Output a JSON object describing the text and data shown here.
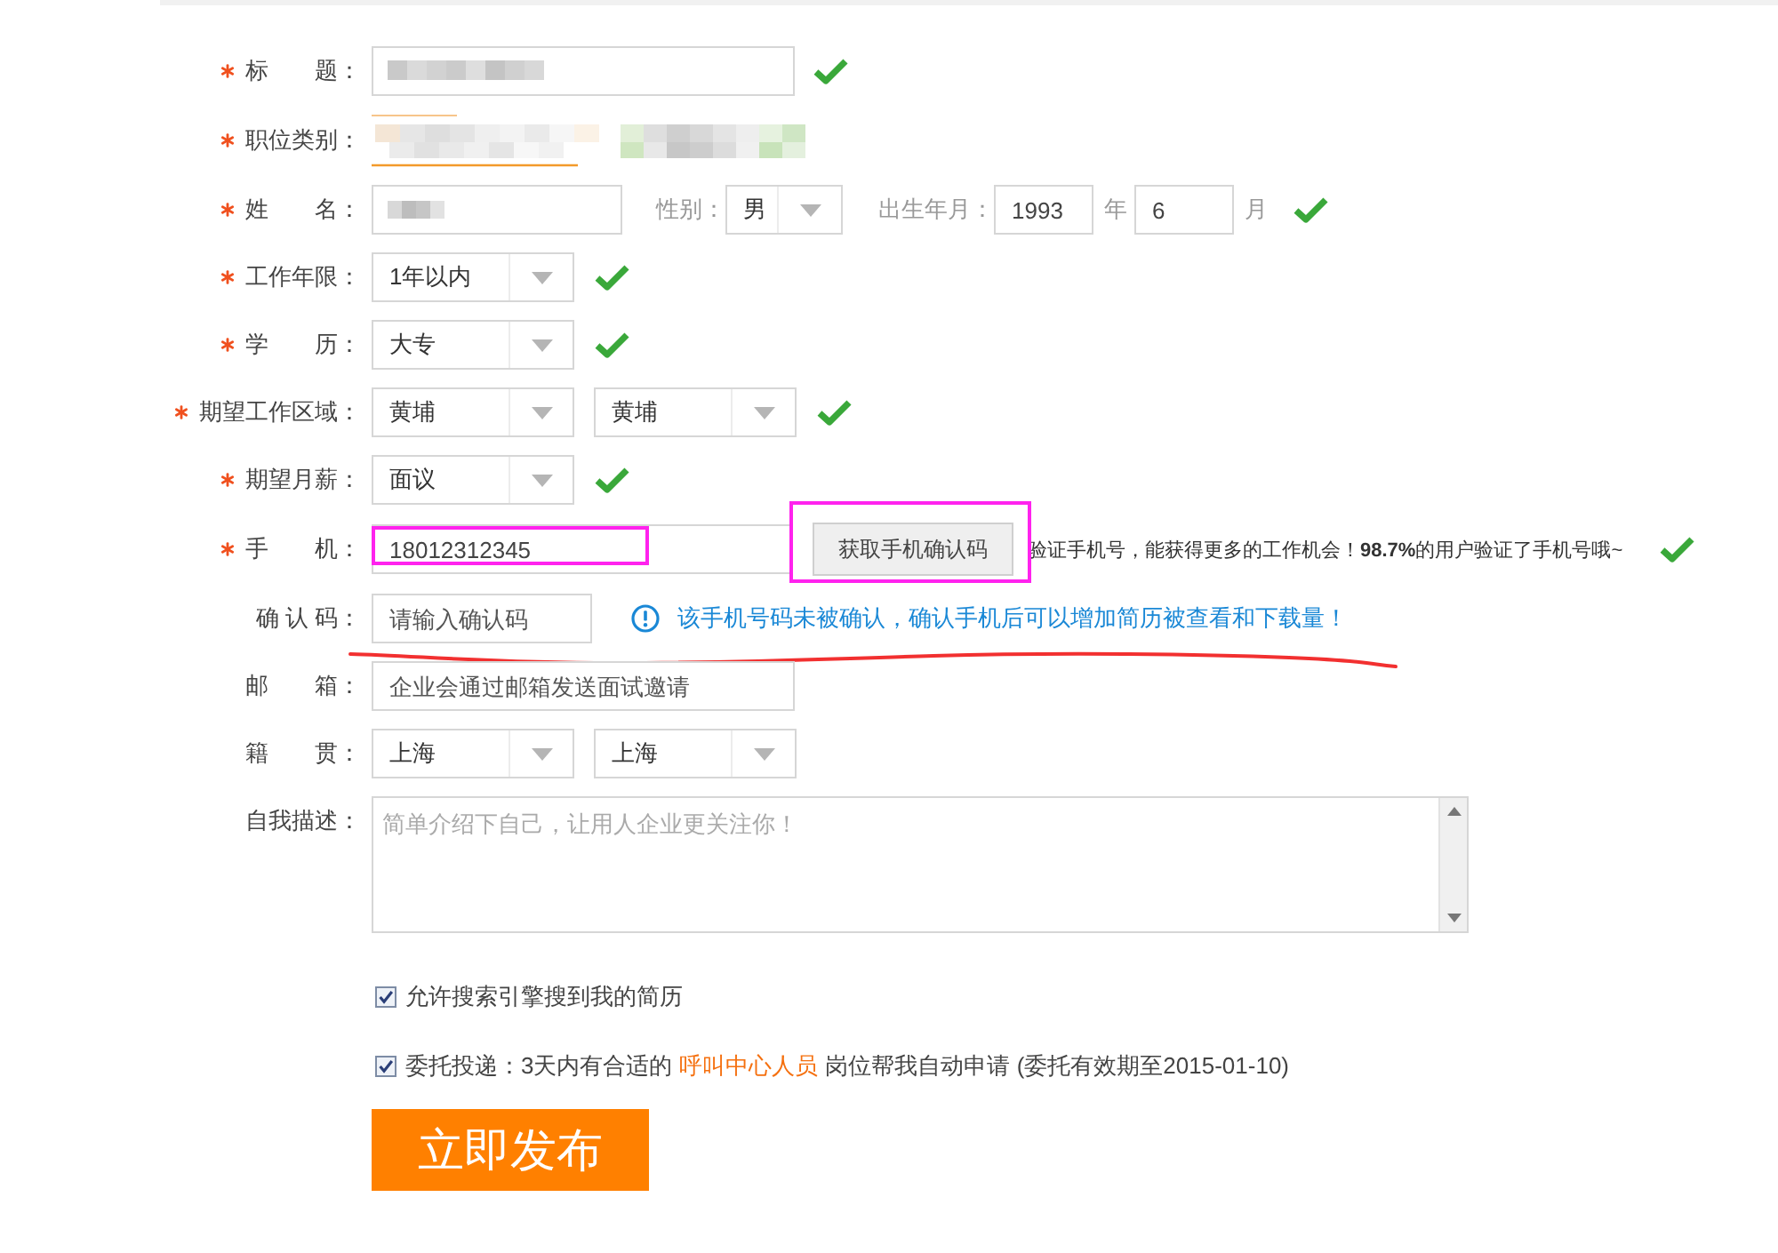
{
  "title": {
    "label": "标　　题：",
    "required": true,
    "blurred": true,
    "valid": true
  },
  "category": {
    "label": "职位类别：",
    "required": true,
    "blurred": true,
    "focused": true
  },
  "name": {
    "label": "姓　　名：",
    "required": true,
    "blurred": true,
    "gender": {
      "label": "性别：",
      "value": "男"
    },
    "birth": {
      "label": "出生年月：",
      "year": "1993",
      "year_unit": "年",
      "month": "6",
      "month_unit": "月"
    },
    "valid": true
  },
  "select_rows": [
    {
      "label": "工作年限：",
      "required": true,
      "values": [
        "1年以内"
      ],
      "valid": true
    },
    {
      "label": "学　　历：",
      "required": true,
      "values": [
        "大专"
      ],
      "valid": true
    },
    {
      "label": "期望工作区域：",
      "required": true,
      "values": [
        "黄埔",
        "黄埔"
      ],
      "valid": true
    },
    {
      "label": "期望月薪：",
      "required": true,
      "values": [
        "面议"
      ],
      "valid": true
    }
  ],
  "phone": {
    "label": "手　　机：",
    "required": true,
    "value": "18012312345",
    "highlighted": true,
    "button": {
      "label": "获取手机确认码",
      "highlighted": true
    },
    "notice": "验证手机号，能获得更多的工作机会！**98.7%**的用户验证了手机号哦~",
    "valid": true
  },
  "code": {
    "label": "确 认 码：",
    "placeholder": "请输入确认码",
    "notice": "该手机号码未被确认，确认手机后可以增加简历被查看和下载量！",
    "underlined": true
  },
  "email": {
    "label": "邮　　箱：",
    "placeholder": "企业会通过邮箱发送面试邀请"
  },
  "hometown": {
    "label": "籍　　贯：",
    "values": [
      "上海",
      "上海"
    ]
  },
  "description": {
    "label": "自我描述：",
    "placeholder": "简单介绍下自己，让用人企业更关注你！"
  },
  "options": [
    {
      "checked": true,
      "text": "允许搜索引擎搜到我的简历"
    },
    {
      "checked": true,
      "text": "委托投递：3天内有合适的",
      "link": "呼叫中心人员",
      "after": "岗位帮我自动申请 (委托有效期至2015-01-10)"
    }
  ],
  "submit": {
    "label": "立即发布"
  }
}
